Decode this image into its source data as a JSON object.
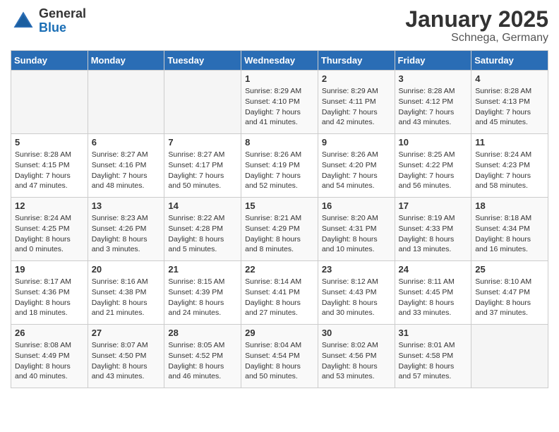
{
  "header": {
    "logo_general": "General",
    "logo_blue": "Blue",
    "title": "January 2025",
    "location": "Schnega, Germany"
  },
  "days_of_week": [
    "Sunday",
    "Monday",
    "Tuesday",
    "Wednesday",
    "Thursday",
    "Friday",
    "Saturday"
  ],
  "weeks": [
    [
      {
        "day": "",
        "info": ""
      },
      {
        "day": "",
        "info": ""
      },
      {
        "day": "",
        "info": ""
      },
      {
        "day": "1",
        "info": "Sunrise: 8:29 AM\nSunset: 4:10 PM\nDaylight: 7 hours\nand 41 minutes."
      },
      {
        "day": "2",
        "info": "Sunrise: 8:29 AM\nSunset: 4:11 PM\nDaylight: 7 hours\nand 42 minutes."
      },
      {
        "day": "3",
        "info": "Sunrise: 8:28 AM\nSunset: 4:12 PM\nDaylight: 7 hours\nand 43 minutes."
      },
      {
        "day": "4",
        "info": "Sunrise: 8:28 AM\nSunset: 4:13 PM\nDaylight: 7 hours\nand 45 minutes."
      }
    ],
    [
      {
        "day": "5",
        "info": "Sunrise: 8:28 AM\nSunset: 4:15 PM\nDaylight: 7 hours\nand 47 minutes."
      },
      {
        "day": "6",
        "info": "Sunrise: 8:27 AM\nSunset: 4:16 PM\nDaylight: 7 hours\nand 48 minutes."
      },
      {
        "day": "7",
        "info": "Sunrise: 8:27 AM\nSunset: 4:17 PM\nDaylight: 7 hours\nand 50 minutes."
      },
      {
        "day": "8",
        "info": "Sunrise: 8:26 AM\nSunset: 4:19 PM\nDaylight: 7 hours\nand 52 minutes."
      },
      {
        "day": "9",
        "info": "Sunrise: 8:26 AM\nSunset: 4:20 PM\nDaylight: 7 hours\nand 54 minutes."
      },
      {
        "day": "10",
        "info": "Sunrise: 8:25 AM\nSunset: 4:22 PM\nDaylight: 7 hours\nand 56 minutes."
      },
      {
        "day": "11",
        "info": "Sunrise: 8:24 AM\nSunset: 4:23 PM\nDaylight: 7 hours\nand 58 minutes."
      }
    ],
    [
      {
        "day": "12",
        "info": "Sunrise: 8:24 AM\nSunset: 4:25 PM\nDaylight: 8 hours\nand 0 minutes."
      },
      {
        "day": "13",
        "info": "Sunrise: 8:23 AM\nSunset: 4:26 PM\nDaylight: 8 hours\nand 3 minutes."
      },
      {
        "day": "14",
        "info": "Sunrise: 8:22 AM\nSunset: 4:28 PM\nDaylight: 8 hours\nand 5 minutes."
      },
      {
        "day": "15",
        "info": "Sunrise: 8:21 AM\nSunset: 4:29 PM\nDaylight: 8 hours\nand 8 minutes."
      },
      {
        "day": "16",
        "info": "Sunrise: 8:20 AM\nSunset: 4:31 PM\nDaylight: 8 hours\nand 10 minutes."
      },
      {
        "day": "17",
        "info": "Sunrise: 8:19 AM\nSunset: 4:33 PM\nDaylight: 8 hours\nand 13 minutes."
      },
      {
        "day": "18",
        "info": "Sunrise: 8:18 AM\nSunset: 4:34 PM\nDaylight: 8 hours\nand 16 minutes."
      }
    ],
    [
      {
        "day": "19",
        "info": "Sunrise: 8:17 AM\nSunset: 4:36 PM\nDaylight: 8 hours\nand 18 minutes."
      },
      {
        "day": "20",
        "info": "Sunrise: 8:16 AM\nSunset: 4:38 PM\nDaylight: 8 hours\nand 21 minutes."
      },
      {
        "day": "21",
        "info": "Sunrise: 8:15 AM\nSunset: 4:39 PM\nDaylight: 8 hours\nand 24 minutes."
      },
      {
        "day": "22",
        "info": "Sunrise: 8:14 AM\nSunset: 4:41 PM\nDaylight: 8 hours\nand 27 minutes."
      },
      {
        "day": "23",
        "info": "Sunrise: 8:12 AM\nSunset: 4:43 PM\nDaylight: 8 hours\nand 30 minutes."
      },
      {
        "day": "24",
        "info": "Sunrise: 8:11 AM\nSunset: 4:45 PM\nDaylight: 8 hours\nand 33 minutes."
      },
      {
        "day": "25",
        "info": "Sunrise: 8:10 AM\nSunset: 4:47 PM\nDaylight: 8 hours\nand 37 minutes."
      }
    ],
    [
      {
        "day": "26",
        "info": "Sunrise: 8:08 AM\nSunset: 4:49 PM\nDaylight: 8 hours\nand 40 minutes."
      },
      {
        "day": "27",
        "info": "Sunrise: 8:07 AM\nSunset: 4:50 PM\nDaylight: 8 hours\nand 43 minutes."
      },
      {
        "day": "28",
        "info": "Sunrise: 8:05 AM\nSunset: 4:52 PM\nDaylight: 8 hours\nand 46 minutes."
      },
      {
        "day": "29",
        "info": "Sunrise: 8:04 AM\nSunset: 4:54 PM\nDaylight: 8 hours\nand 50 minutes."
      },
      {
        "day": "30",
        "info": "Sunrise: 8:02 AM\nSunset: 4:56 PM\nDaylight: 8 hours\nand 53 minutes."
      },
      {
        "day": "31",
        "info": "Sunrise: 8:01 AM\nSunset: 4:58 PM\nDaylight: 8 hours\nand 57 minutes."
      },
      {
        "day": "",
        "info": ""
      }
    ]
  ]
}
